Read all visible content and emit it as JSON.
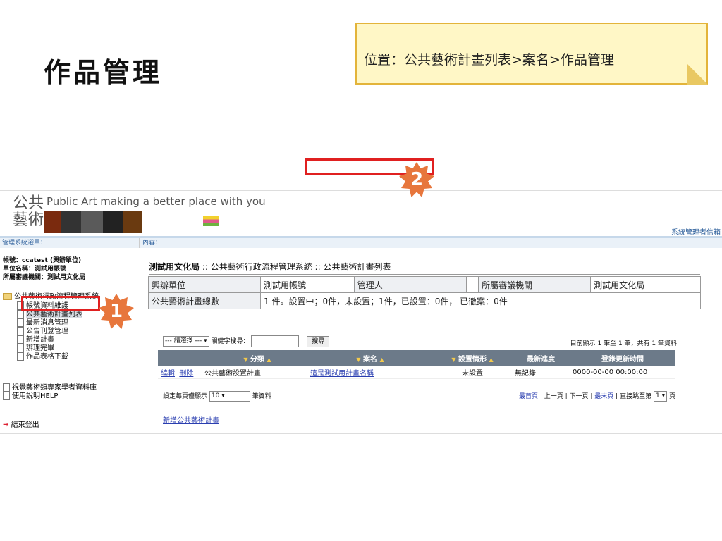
{
  "slide": {
    "title": "作品管理",
    "location_note": "位置：公共藝術計畫列表>案名>作品管理"
  },
  "app": {
    "logo_cn_line1": "公共",
    "logo_cn_line2": "藝術",
    "logo_en": "Public Art making a better place with you",
    "mailbox": "系統管理者信箱"
  },
  "left_panel": {
    "header": "管理系統選單：",
    "info": [
      "帳號：ccatest (興辦單位)",
      "單位名稱：測試用帳號",
      "所屬審議機關：測試用文化局"
    ],
    "tree_root": "公共藝術行政流程管理系統",
    "tree_items": [
      "帳號資料維護",
      "公共藝術計畫列表",
      "最新消息管理",
      "公告刊登管理",
      "新增計畫",
      "辦理完畢",
      "作品表格下載"
    ],
    "bottom_links": [
      "視覺藝術類專家學者資料庫",
      "使用說明HELP"
    ],
    "logout": "結束登出"
  },
  "content": {
    "header": "內容：",
    "page_title_org": "測試用文化局",
    "page_title_rest": " :: 公共藝術行政流程管理系統 :: 公共藝術計畫列表",
    "summary": {
      "row1": [
        "興辦單位",
        "測試用帳號",
        "管理人",
        "",
        "所屬審議機關",
        "測試用文化局"
      ],
      "row2_label": "公共藝術計畫總數",
      "row2_value": "1 件。設置中；0件，未設置；1件，已設置：0件，  已徹案：0件"
    },
    "search": {
      "select": "--- 請選擇 ---",
      "keyword_label": "關鍵字搜尋：",
      "keyword_value": "",
      "button": "搜尋"
    },
    "record_info": "目前顯示 1 筆至 1 筆，共有 1 筆資料",
    "columns": [
      "",
      "",
      "分類",
      "案名",
      "設置情形",
      "最新進度",
      "登錄更新時間"
    ],
    "rows": [
      {
        "edit": "編輯",
        "delete": "刪除",
        "category": "公共藝術設置計畫",
        "name": "這是測試用計畫名稱",
        "status": "未設置",
        "progress": "無記錄",
        "updated": "0000-00-00 00:00:00"
      }
    ],
    "per_page_label": "設定每頁僅顯示",
    "per_page_value": "10",
    "per_page_unit": "筆資料",
    "pager": {
      "first": "最首頁",
      "prev": "上一頁",
      "next": "下一頁",
      "last": "最末頁",
      "jump": "直接跳至第",
      "page": "1",
      "page_unit": "頁"
    },
    "add_link": "新增公共藝術計畫"
  },
  "annotations": [
    "1",
    "2"
  ],
  "colors": {
    "highlight": "#e02020",
    "star": "#e7763c",
    "note_bg": "#fff7c6",
    "grid_head": "#6c7a89"
  }
}
